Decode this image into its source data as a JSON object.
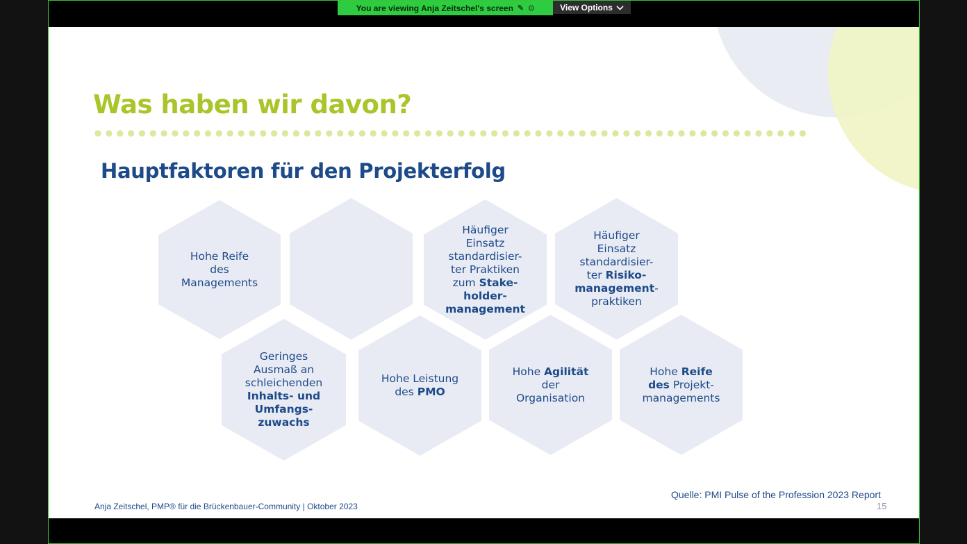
{
  "sharing": {
    "viewing_text": "You are viewing  Anja Zeitschel's screen",
    "view_options_label": "View Options",
    "view_options_icon": "chevron-down-icon"
  },
  "slide": {
    "title": "Was haben wir davon?",
    "subtitle": "Hauptfaktoren für den Projekterfolg",
    "colors": {
      "title_green": "#a9c52a",
      "text_blue": "#1d4a88",
      "hex_fill": "#e8ebf4",
      "dot_green": "#dbe89e"
    },
    "hexagons": {
      "h1": {
        "line1": "Hohe Reife",
        "line2": "des",
        "line3": "Managements"
      },
      "h3": {
        "line1": "Häufiger",
        "line2": "Einsatz",
        "line3": "standardisier-",
        "line4": "ter Praktiken",
        "line5a": "zum ",
        "line5b": "Stake-",
        "line6": "holder-",
        "line7": "management"
      },
      "h4": {
        "line1": "Häufiger",
        "line2": "Einsatz",
        "line3": "standardisier-",
        "line4a": "ter ",
        "line4b": "Risiko-",
        "line5a": "management",
        "line5b": "-",
        "line6": "praktiken"
      },
      "h5": {
        "line1": "Geringes",
        "line2": "Ausmaß an",
        "line3": "schleichenden",
        "line4": "Inhalts- und",
        "line5": "Umfangs-",
        "line6": "zuwachs"
      },
      "h6": {
        "line1": "Hohe Leistung",
        "line2a": "des ",
        "line2b": "PMO"
      },
      "h7": {
        "line1a": "Hohe ",
        "line1b": "Agilität",
        "line2": "der",
        "line3": "Organisation"
      },
      "h8": {
        "line1a": "Hohe ",
        "line1b": "Reife",
        "line2a": "des",
        "line2b": " Projekt-",
        "line3": "managements"
      }
    },
    "footer": "Anja Zeitschel, PMP® für die Brückenbauer-Community  | Oktober 2023",
    "source": "Quelle: PMI Pulse of the Profession 2023 Report",
    "page_number": "15"
  }
}
